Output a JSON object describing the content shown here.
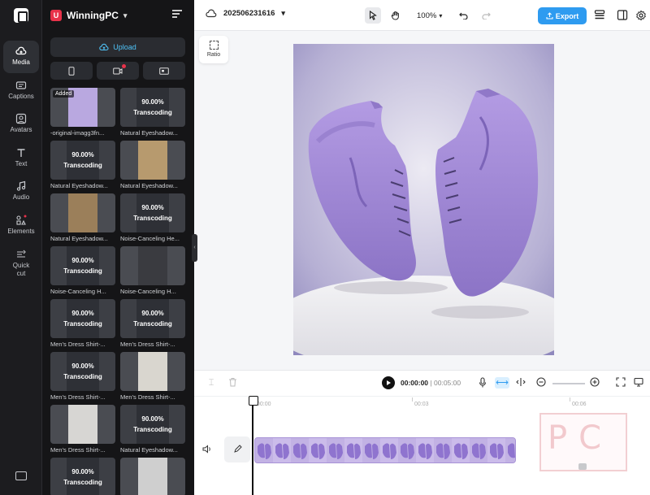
{
  "rail": {
    "items": [
      {
        "label": "Media",
        "icon": "cloud-upload-icon",
        "active": true
      },
      {
        "label": "Captions",
        "icon": "captions-icon",
        "active": false
      },
      {
        "label": "Avatars",
        "icon": "avatar-icon",
        "active": false
      },
      {
        "label": "Text",
        "icon": "text-icon",
        "active": false
      },
      {
        "label": "Audio",
        "icon": "music-note-icon",
        "active": false
      },
      {
        "label": "Elements",
        "icon": "elements-icon",
        "active": false
      },
      {
        "label": "Quick cut",
        "icon": "quick-cut-icon",
        "active": false
      }
    ],
    "bottom_icon": "keyboard-icon"
  },
  "panel": {
    "workspace_name": "WinningPC",
    "workspace_badge": "U",
    "upload_label": "Upload",
    "media": [
      {
        "status": "",
        "added_label": "Added",
        "caption": "-original-imagg3fn...",
        "thumb": "shoe-image"
      },
      {
        "status": "90.00%",
        "status2": "Transcoding",
        "caption": "Natural Eyeshadow..."
      },
      {
        "status": "90.00%",
        "status2": "Transcoding",
        "caption": "Natural Eyeshadow..."
      },
      {
        "status": "",
        "caption": "Natural Eyeshadow...",
        "thumb": "eyeshadow-image"
      },
      {
        "status": "",
        "caption": "Natural Eyeshadow...",
        "thumb": "eyeshadow-box-image"
      },
      {
        "status": "90.00%",
        "status2": "Transcoding",
        "caption": "Noise-Canceling He..."
      },
      {
        "status": "90.00%",
        "status2": "Transcoding",
        "caption": "Noise-Canceling H..."
      },
      {
        "status": "",
        "caption": "Noise-Canceling H...",
        "thumb": "headphones-image"
      },
      {
        "status": "90.00%",
        "status2": "Transcoding",
        "caption": "Men's Dress Shirt-..."
      },
      {
        "status": "90.00%",
        "status2": "Transcoding",
        "caption": "Men's Dress Shirt-..."
      },
      {
        "status": "90.00%",
        "status2": "Transcoding",
        "caption": "Men's Dress Shirt-..."
      },
      {
        "status": "",
        "caption": "Men's Dress Shirt-...",
        "thumb": "shirt-image"
      },
      {
        "status": "",
        "caption": "Men's Dress Shirt-...",
        "thumb": "man-shirt-image"
      },
      {
        "status": "90.00%",
        "status2": "Transcoding",
        "caption": "Natural Eyeshadow..."
      },
      {
        "status": "90.00%",
        "status2": "Transcoding",
        "caption": ""
      },
      {
        "status": "",
        "caption": "",
        "thumb": "product-image"
      }
    ]
  },
  "topbar": {
    "project_name": "202506231616",
    "zoom": "100%",
    "export_label": "Export"
  },
  "canvas": {
    "ratio_label": "Ratio"
  },
  "timeline": {
    "current_time": "00:00:00",
    "separator": "|",
    "duration": "00:05:00",
    "ticks": [
      "00:00",
      "00:03",
      "00:06"
    ],
    "watermark_text": "PC"
  },
  "colors": {
    "accent": "#2e9bf0",
    "upload_text": "#4fc3f7",
    "brand_badge": "#e8324a",
    "shoe": "#a08ad3"
  }
}
